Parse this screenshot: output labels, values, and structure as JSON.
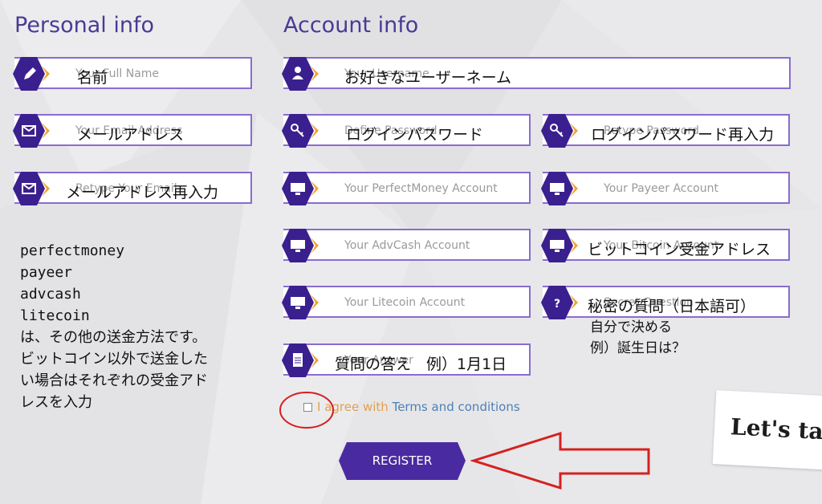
{
  "sections": {
    "personal_title": "Personal info",
    "account_title": "Account info"
  },
  "personal": {
    "full_name": {
      "placeholder": "Your Full Name",
      "annotation": "名前",
      "icon": "pencil-icon"
    },
    "email": {
      "placeholder": "Your Email Address",
      "annotation": "メールアドレス",
      "icon": "envelope-icon"
    },
    "email_retype": {
      "placeholder": "Retype Your Email",
      "annotation": "メールアドレス再入力",
      "icon": "envelope-icon"
    }
  },
  "account": {
    "username": {
      "placeholder": "Your Username",
      "annotation": "お好きなユーザーネーム",
      "icon": "user-icon"
    },
    "password": {
      "placeholder": "Define Password",
      "annotation": "ログインパスワード",
      "icon": "key-icon"
    },
    "password_retype": {
      "placeholder": "Retype Password",
      "annotation": "ログインパスワード再入力",
      "icon": "key-icon"
    },
    "perfectmoney": {
      "placeholder": "Your PerfectMoney Account",
      "icon": "monitor-icon"
    },
    "payeer": {
      "placeholder": "Your Payeer Account",
      "icon": "monitor-icon"
    },
    "advcash": {
      "placeholder": "Your AdvCash Account",
      "icon": "monitor-icon"
    },
    "bitcoin": {
      "placeholder": "Your Bitcoin Account",
      "annotation": "ビットコイン受金アドレス",
      "icon": "monitor-icon"
    },
    "litecoin": {
      "placeholder": "Your Litecoin Account",
      "icon": "monitor-icon"
    },
    "secret_question": {
      "placeholder": "Secret Question",
      "annotation": "秘密の質問（日本語可）",
      "icon": "question-icon"
    },
    "answer": {
      "placeholder": "Your Answer",
      "annotation": "質問の答え　例）1月1日",
      "icon": "document-icon"
    }
  },
  "notes": {
    "payment_lines": [
      "perfectmoney",
      "payeer",
      "advcash",
      "litecoin"
    ],
    "payment_desc": [
      "は、その他の送金方法です。",
      "ビットコイン以外で送金した",
      "い場合はそれぞれの受金アド",
      "レスを入力"
    ],
    "secret_desc": [
      "自分で決める",
      "例）誕生日は？"
    ]
  },
  "terms": {
    "agree": "I agree with",
    "link": "Terms and conditions"
  },
  "register_label": "REGISTER",
  "sticker_text": "Let's ta",
  "colors": {
    "hex": "#3a1f8f",
    "border": "#8a6ccf",
    "arrow_orange": "#f2a030",
    "annotation_red": "#d62020",
    "button": "#4a2aa0"
  }
}
